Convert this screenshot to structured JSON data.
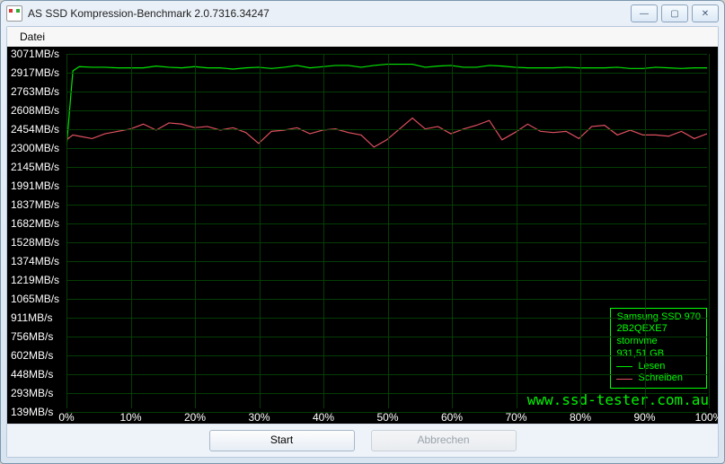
{
  "titlebar": {
    "title": "AS SSD Kompression-Benchmark 2.0.7316.34247"
  },
  "menu": {
    "datei": "Datei"
  },
  "buttons": {
    "start": "Start",
    "abort": "Abbrechen"
  },
  "legend": {
    "device": "Samsung SSD 970",
    "fw": "2B2QEXE7",
    "driver": "stornvme",
    "size": "931,51 GB",
    "read": "Lesen",
    "write": "Schreiben"
  },
  "watermark": "www.ssd-tester.com.au",
  "chart_data": {
    "type": "line",
    "title": "AS SSD Kompression-Benchmark",
    "xlabel": "",
    "ylabel": "MB/s",
    "ylim": [
      139,
      3071
    ],
    "xlim": [
      0,
      100
    ],
    "y_ticks": [
      139,
      293,
      448,
      602,
      756,
      911,
      1065,
      1219,
      1374,
      1528,
      1682,
      1837,
      1991,
      2145,
      2300,
      2454,
      2608,
      2763,
      2917,
      3071
    ],
    "y_tick_labels": [
      "139MB/s",
      "293MB/s",
      "448MB/s",
      "602MB/s",
      "756MB/s",
      "911MB/s",
      "1065MB/s",
      "1219MB/s",
      "1374MB/s",
      "1528MB/s",
      "1682MB/s",
      "1837MB/s",
      "1991MB/s",
      "2145MB/s",
      "2300MB/s",
      "2454MB/s",
      "2608MB/s",
      "2763MB/s",
      "2917MB/s",
      "3071MB/s"
    ],
    "x_ticks": [
      0,
      10,
      20,
      30,
      40,
      50,
      60,
      70,
      80,
      90,
      100
    ],
    "x_tick_labels": [
      "0%",
      "10%",
      "20%",
      "30%",
      "40%",
      "50%",
      "60%",
      "70%",
      "80%",
      "90%",
      "100%"
    ],
    "series": [
      {
        "name": "Lesen",
        "color": "#00e600",
        "x": [
          0,
          1,
          2,
          4,
          6,
          8,
          10,
          12,
          14,
          16,
          18,
          20,
          22,
          24,
          26,
          28,
          30,
          32,
          34,
          36,
          38,
          40,
          42,
          44,
          46,
          48,
          50,
          52,
          54,
          56,
          58,
          60,
          62,
          64,
          66,
          68,
          70,
          72,
          74,
          76,
          78,
          80,
          82,
          84,
          86,
          88,
          90,
          92,
          94,
          96,
          98,
          100
        ],
        "y": [
          2300,
          2930,
          2965,
          2960,
          2960,
          2955,
          2955,
          2955,
          2970,
          2960,
          2955,
          2965,
          2955,
          2955,
          2945,
          2955,
          2960,
          2950,
          2960,
          2975,
          2955,
          2965,
          2975,
          2975,
          2960,
          2975,
          2985,
          2985,
          2985,
          2960,
          2970,
          2975,
          2960,
          2960,
          2975,
          2970,
          2960,
          2955,
          2955,
          2955,
          2960,
          2955,
          2955,
          2955,
          2960,
          2950,
          2950,
          2960,
          2955,
          2950,
          2955,
          2955
        ]
      },
      {
        "name": "Schreiben",
        "color": "#e05060",
        "x": [
          0,
          1,
          2,
          4,
          6,
          8,
          10,
          12,
          14,
          16,
          18,
          20,
          22,
          24,
          26,
          28,
          30,
          32,
          34,
          36,
          38,
          40,
          42,
          44,
          46,
          48,
          50,
          52,
          54,
          56,
          58,
          60,
          62,
          64,
          66,
          68,
          70,
          72,
          74,
          76,
          78,
          80,
          82,
          84,
          86,
          88,
          90,
          92,
          94,
          96,
          98,
          100
        ],
        "y": [
          2360,
          2400,
          2390,
          2370,
          2410,
          2430,
          2450,
          2490,
          2440,
          2500,
          2490,
          2460,
          2470,
          2440,
          2460,
          2420,
          2330,
          2430,
          2440,
          2460,
          2410,
          2440,
          2450,
          2420,
          2400,
          2300,
          2360,
          2450,
          2540,
          2450,
          2470,
          2410,
          2450,
          2480,
          2520,
          2360,
          2420,
          2490,
          2430,
          2420,
          2430,
          2370,
          2470,
          2480,
          2400,
          2440,
          2400,
          2400,
          2390,
          2430,
          2370,
          2410
        ]
      }
    ]
  }
}
